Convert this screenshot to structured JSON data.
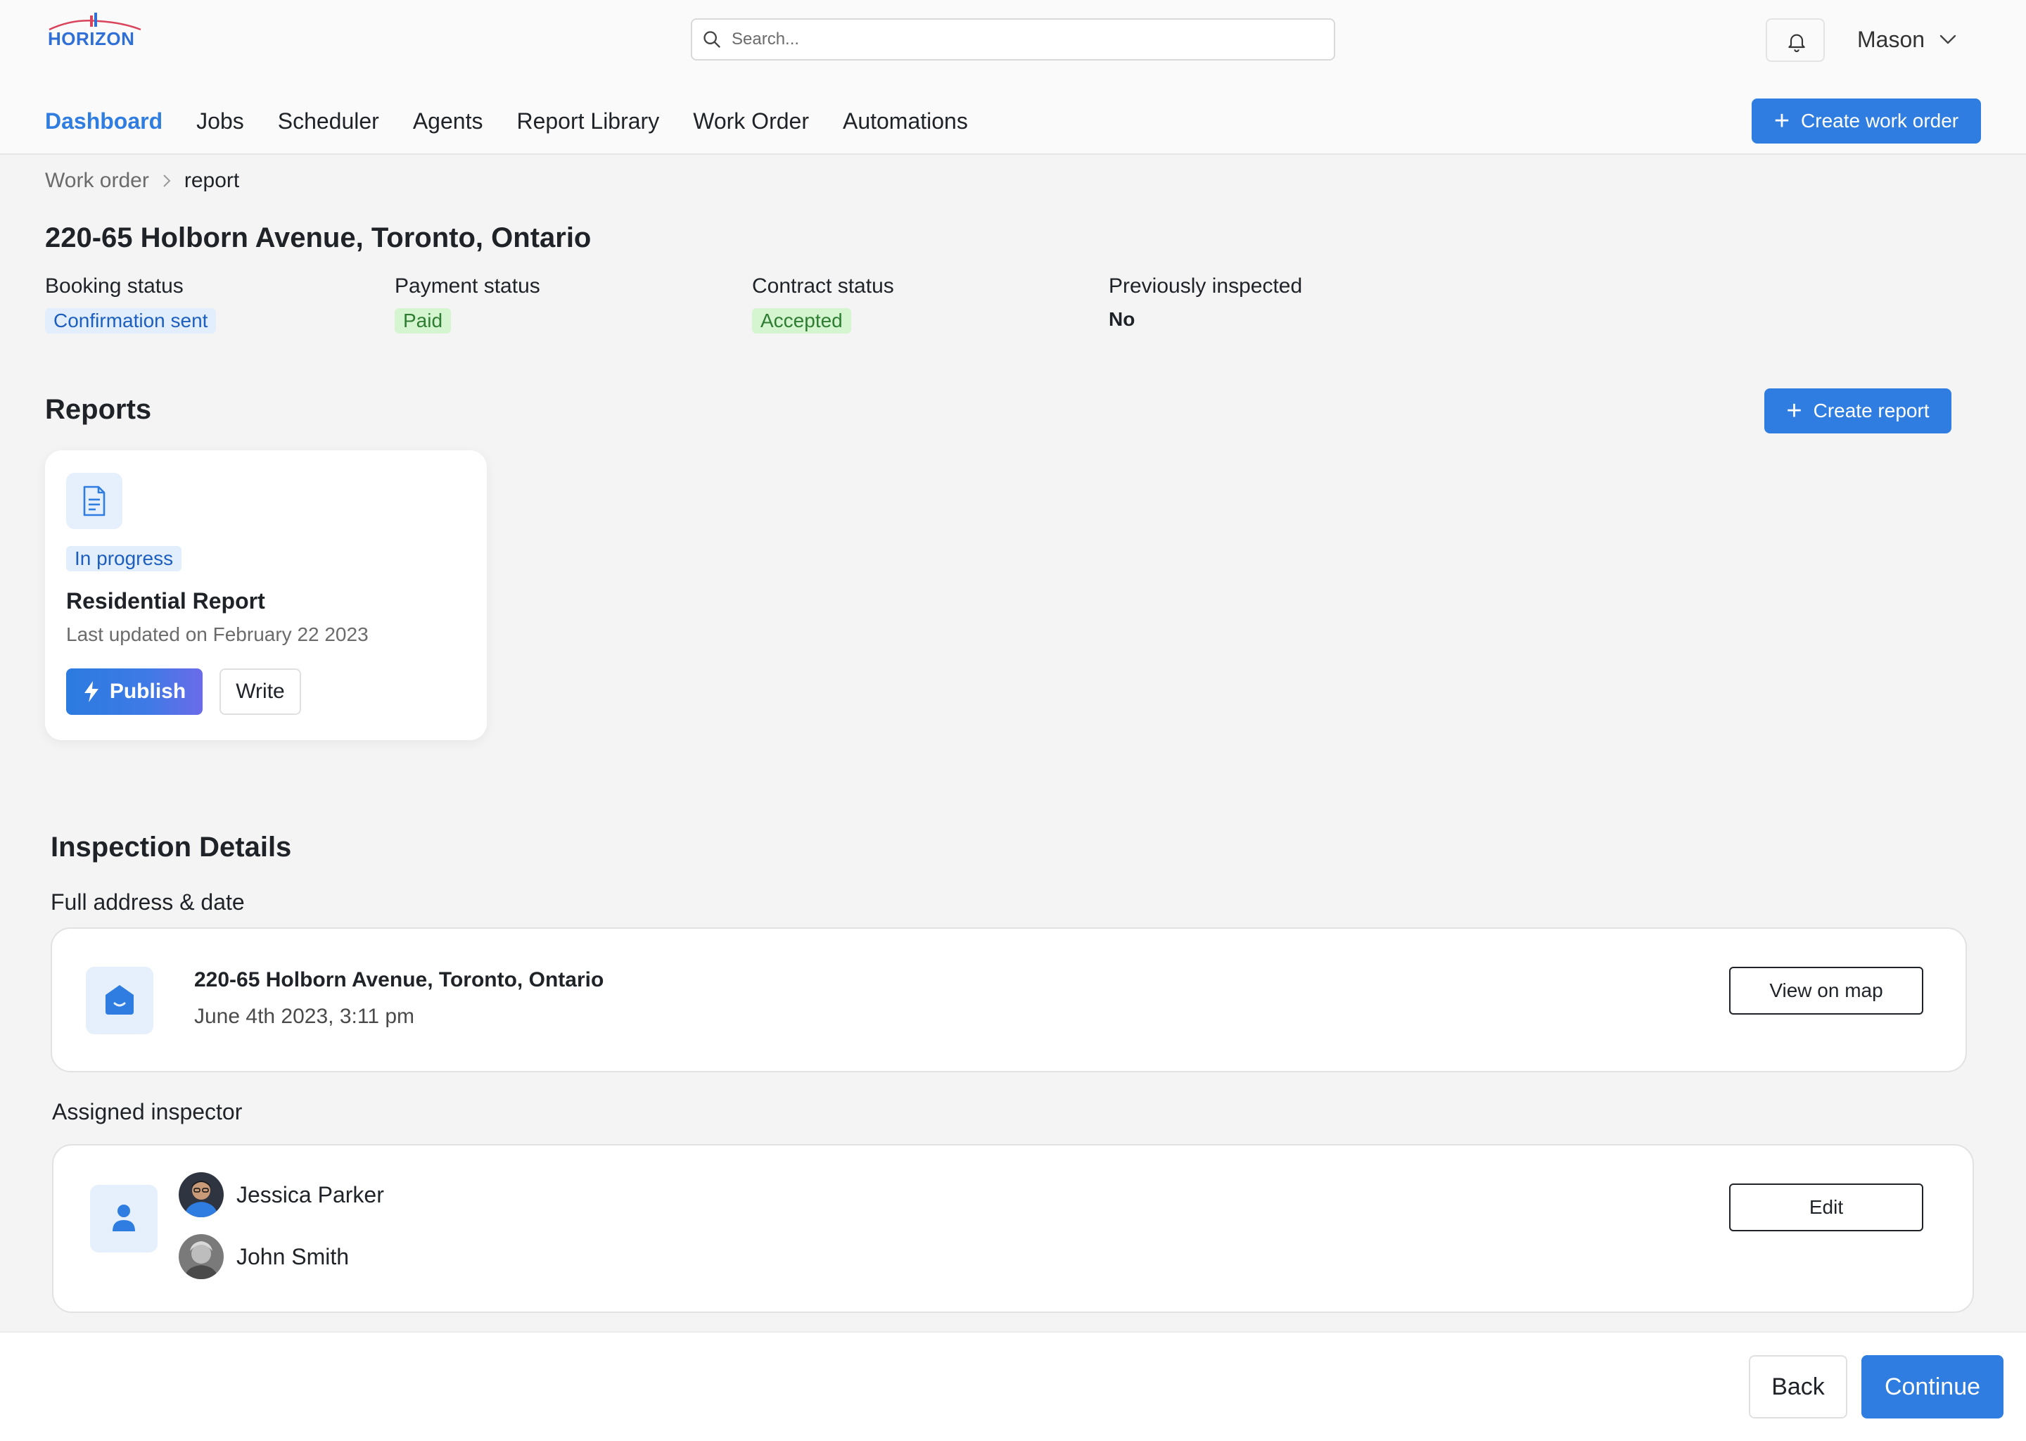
{
  "brand": {
    "logo_text": "HORIZON",
    "accent": "#2f7de1"
  },
  "header": {
    "search_placeholder": "Search...",
    "user_name": "Mason",
    "nav": [
      "Dashboard",
      "Jobs",
      "Scheduler",
      "Agents",
      "Report Library",
      "Work Order",
      "Automations"
    ],
    "active_nav": "Dashboard",
    "create_work_order_label": "Create work order"
  },
  "breadcrumb": {
    "parent": "Work order",
    "current": "report"
  },
  "page": {
    "title": "220-65 Holborn Avenue, Toronto, Ontario",
    "statuses": [
      {
        "label": "Booking status",
        "value": "Confirmation sent",
        "color": "#1d5fbf"
      },
      {
        "label": "Payment status",
        "value": "Paid",
        "color": "#2e7d32"
      },
      {
        "label": "Contract status",
        "value": "Accepted",
        "color": "#2e7d32"
      },
      {
        "label": "Previously inspected",
        "value": "No"
      }
    ]
  },
  "reports": {
    "title": "Reports",
    "create_label": "Create report",
    "card": {
      "icon": "document-icon",
      "status": "In progress",
      "name": "Residential Report",
      "updated": "Last updated on February 22 2023",
      "publish_label": "Publish",
      "write_label": "Write"
    }
  },
  "inspection": {
    "title": "Inspection Details",
    "address_section_label": "Full address & date",
    "address": "220-65 Holborn Avenue, Toronto, Ontario",
    "date": "June 4th 2023, 3:11 pm",
    "view_map_label": "View on map",
    "inspector_section_label": "Assigned inspector",
    "inspectors": [
      "Jessica Parker",
      "John Smith"
    ],
    "edit_label": "Edit"
  },
  "footer": {
    "back_label": "Back",
    "continue_label": "Continue"
  }
}
